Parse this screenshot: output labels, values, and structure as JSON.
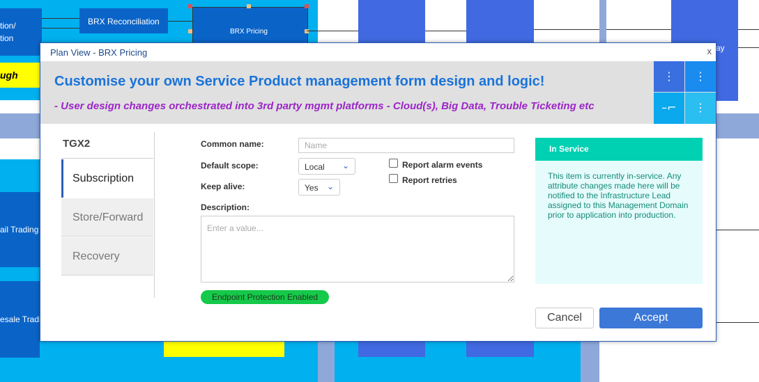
{
  "background": {
    "box_fragment_1": "tion/\ntion",
    "box_fragment_2": "ugh",
    "reconciliation_label": "BRX Reconciliation",
    "pricing_label": "BRX Pricing",
    "right_fragment": "ay",
    "left_fragment_3": "ail Trading",
    "left_fragment_4": "esale Tradi"
  },
  "modal": {
    "title": "Plan View - BRX Pricing",
    "close_label": "x"
  },
  "banner": {
    "heading": "Customise your own Service Product management form design and logic!",
    "subheading": "- User design changes orchestrated into 3rd party mgmt platforms - Cloud(s), Big Data, Trouble Ticketing etc",
    "icon_buttons": [
      {
        "glyph": "⋮",
        "color": "#3a6fe0"
      },
      {
        "glyph": "⋮",
        "color": "#1a8cf0"
      },
      {
        "glyph": "–⌐",
        "color": "#0aa9ee"
      },
      {
        "glyph": "⋮",
        "color": "#2bbef0"
      }
    ]
  },
  "tabs": {
    "header": "TGX2",
    "items": [
      "Subscription",
      "Store/Forward",
      "Recovery"
    ],
    "active_index": 0
  },
  "form": {
    "common_name_label": "Common name:",
    "common_name_placeholder": "Name",
    "default_scope_label": "Default scope:",
    "default_scope_value": "Local",
    "keep_alive_label": "Keep alive:",
    "keep_alive_value": "Yes",
    "report_alarm_label": "Report alarm events",
    "report_retries_label": "Report retries",
    "description_label": "Description:",
    "description_placeholder": "Enter a value...",
    "endpoint_pill": "Endpoint Protection Enabled"
  },
  "status": {
    "title": "In Service",
    "body": "This item is currently in-service. Any attribute changes made here will be notified to the Infrastructure Lead assigned to this Management Domain prior to application into production."
  },
  "actions": {
    "cancel_label": "Cancel",
    "accept_label": "Accept"
  },
  "colors": {
    "accent": "#3b78d8",
    "status_header": "#00d1b2",
    "pill": "#15c94a",
    "heading_blue": "#1a73d9",
    "subheading_purple": "#9b26c7"
  }
}
